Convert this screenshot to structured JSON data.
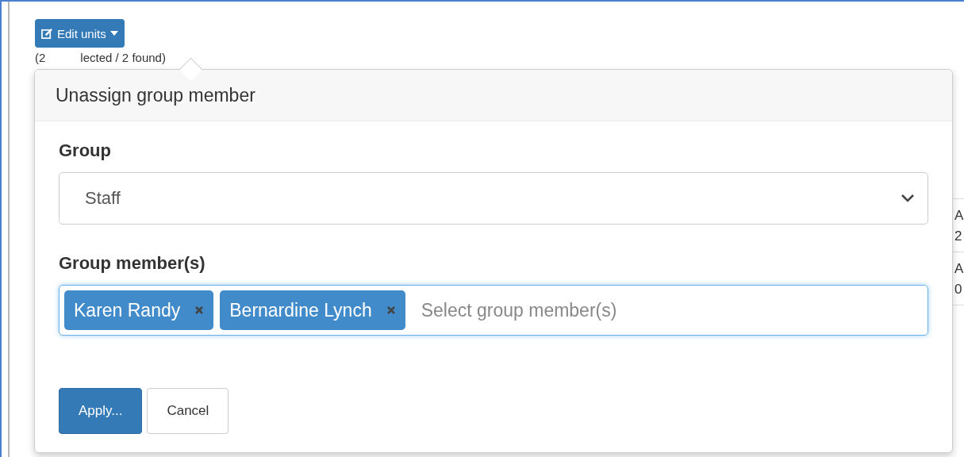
{
  "toolbar": {
    "button": "Edit units"
  },
  "selection_summary": {
    "start": "(2",
    "end": "lected / 2 found)"
  },
  "background_table": {
    "rows": [
      {
        "line_1": "A",
        "line_2": "2"
      },
      {
        "line_1": "A",
        "line_2": "0"
      }
    ]
  },
  "popover": {
    "title": "Unassign group member",
    "group": {
      "label": "Group",
      "value": "Staff"
    },
    "members": {
      "label": "Group member(s)",
      "placeholder": "Select group member(s)",
      "focused": true,
      "tags": [
        "Karen Randy",
        "Bernardine Lynch"
      ]
    },
    "buttons": [
      {
        "label": "Apply...",
        "kind": "primary"
      },
      {
        "label": "Cancel",
        "kind": "default"
      }
    ]
  }
}
